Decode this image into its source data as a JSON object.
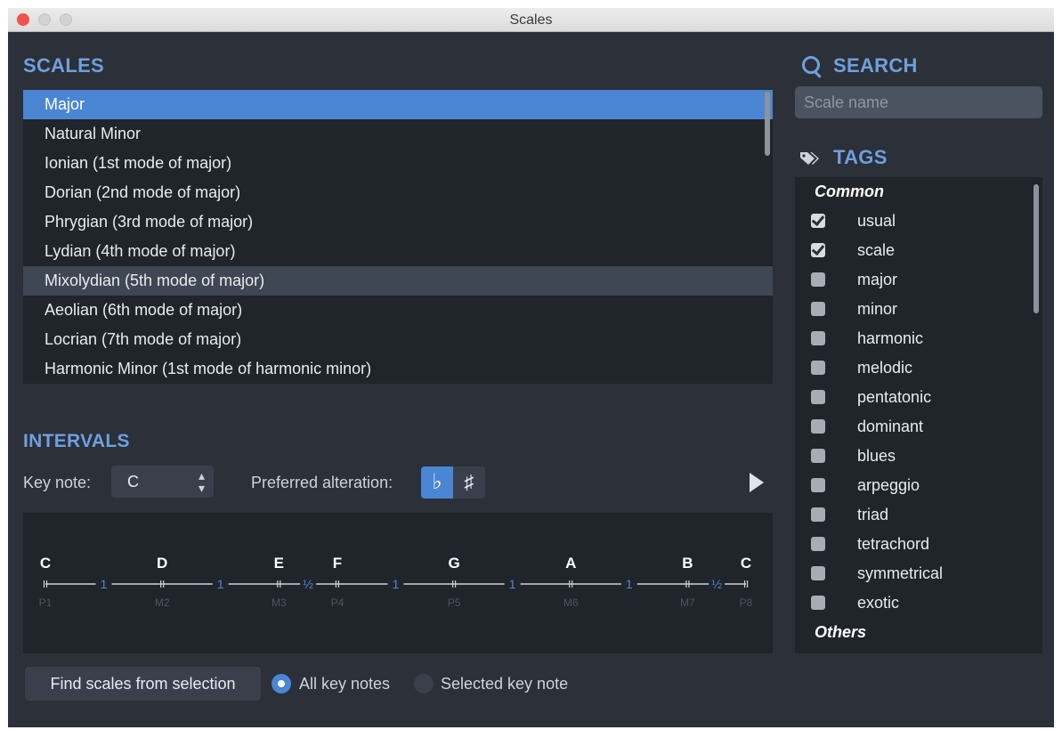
{
  "window": {
    "title": "Scales"
  },
  "scales": {
    "heading": "SCALES",
    "items": [
      "Major",
      "Natural Minor",
      "Ionian (1st mode of major)",
      "Dorian (2nd mode of major)",
      "Phrygian (3rd mode of major)",
      "Lydian (4th mode of major)",
      "Mixolydian (5th mode of major)",
      "Aeolian (6th mode of major)",
      "Locrian (7th mode of major)",
      "Harmonic Minor (1st mode of harmonic minor)"
    ],
    "selected_index": 0,
    "hover_index": 6
  },
  "intervals": {
    "heading": "INTERVALS",
    "key_note_label": "Key note:",
    "key_note_value": "C",
    "preferred_alteration_label": "Preferred alteration:",
    "flat_symbol": "♭",
    "sharp_symbol": "♯",
    "alteration_selected": "flat",
    "notes": [
      "C",
      "D",
      "E",
      "F",
      "G",
      "A",
      "B",
      "C"
    ],
    "degrees": [
      "P1",
      "M2",
      "M3",
      "P4",
      "P5",
      "M6",
      "M7",
      "P8"
    ],
    "steps": [
      "1",
      "1",
      "½",
      "1",
      "1",
      "1",
      "½"
    ],
    "semitone_positions": [
      0,
      2,
      4,
      5,
      7,
      9,
      11,
      12
    ]
  },
  "bottom": {
    "find_button": "Find scales from selection",
    "all_key_notes": "All key notes",
    "selected_key_note": "Selected key note",
    "radio_selected": "all"
  },
  "search": {
    "heading": "SEARCH",
    "placeholder": "Scale name"
  },
  "tags": {
    "heading": "TAGS",
    "groups": [
      {
        "name": "Common",
        "items": [
          {
            "label": "usual",
            "checked": true
          },
          {
            "label": "scale",
            "checked": true
          },
          {
            "label": "major",
            "checked": false
          },
          {
            "label": "minor",
            "checked": false
          },
          {
            "label": "harmonic",
            "checked": false
          },
          {
            "label": "melodic",
            "checked": false
          },
          {
            "label": "pentatonic",
            "checked": false
          },
          {
            "label": "dominant",
            "checked": false
          },
          {
            "label": "blues",
            "checked": false
          },
          {
            "label": "arpeggio",
            "checked": false
          },
          {
            "label": "triad",
            "checked": false
          },
          {
            "label": "tetrachord",
            "checked": false
          },
          {
            "label": "symmetrical",
            "checked": false
          },
          {
            "label": "exotic",
            "checked": false
          }
        ]
      },
      {
        "name": "Others",
        "items": []
      }
    ]
  },
  "colors": {
    "accent": "#4a86d4",
    "heading": "#6fa0dd",
    "panel": "#20242b",
    "window": "#2b3039"
  }
}
